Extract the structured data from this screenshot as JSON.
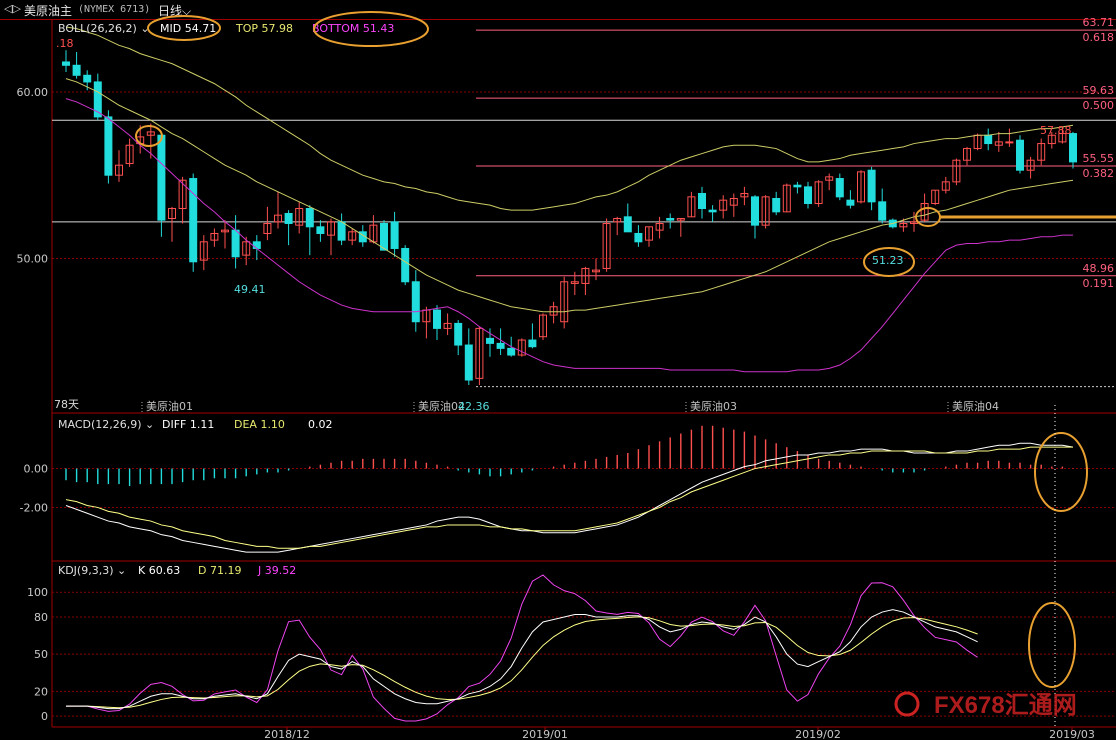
{
  "header": {
    "window_icon": "window-toggle-icon",
    "instrument": "美原油主",
    "code": "(NYMEX 6713)",
    "period": "日线"
  },
  "colors": {
    "up": "#ff5050",
    "down": "#22dddd",
    "boll_mid": "#cccc66",
    "boll_top": "#cccc66",
    "boll_bottom": "#cc33cc",
    "macd_diff": "#ffffff",
    "macd_dea": "#ffff88",
    "kdj_k": "#ffffff",
    "kdj_d": "#ffff88",
    "kdj_j": "#ee44ee",
    "grid": "#8a0000",
    "fib": "#ff6080",
    "annotation": "#e8a030"
  },
  "boll_panel": {
    "label": "BOLL(26,26,2)",
    "mid": "MID 54.71",
    "top": "TOP 57.98",
    "bottom": "BOTTOM 51.43",
    "cut_value": ".18",
    "y_ticks": [
      "60.00",
      "50.00"
    ],
    "days_label": "78天",
    "month_marks": [
      "美原油01",
      "美原油02",
      "美原油03",
      "美原油04"
    ],
    "low_label": "42.36",
    "left_low_label": "49.41",
    "highlight_label": "51.23",
    "high_label": "57.88",
    "fib_levels": [
      {
        "price": "63.71",
        "ratio": "0.618"
      },
      {
        "price": "59.63",
        "ratio": "0.500"
      },
      {
        "price": "55.55",
        "ratio": "0.382"
      },
      {
        "price": "48.96",
        "ratio": "0.191"
      }
    ]
  },
  "macd_panel": {
    "label": "MACD(12,26,9)",
    "diff": "DIFF 1.11",
    "dea": "DEA 1.10",
    "macd": "0.02",
    "y_ticks": [
      "0.00",
      "-2.00"
    ]
  },
  "kdj_panel": {
    "label": "KDJ(9,3,3)",
    "k": "K 60.63",
    "d": "D 71.19",
    "j": "J 39.52",
    "y_ticks": [
      "100",
      "80",
      "50",
      "20",
      "0"
    ]
  },
  "x_axis": [
    "2018/12",
    "2019/01",
    "2019/02",
    "2019/03"
  ],
  "watermark": "FX678汇通网",
  "chart_data": {
    "type": "candlestick",
    "title": "美原油主 (NYMEX 6713) 日线",
    "ylim": [
      41.5,
      64.2
    ],
    "candles": [
      [
        61.8,
        62.5,
        61.2,
        61.6
      ],
      [
        61.6,
        62.4,
        60.8,
        61.0
      ],
      [
        61.0,
        61.3,
        60.1,
        60.6
      ],
      [
        60.6,
        61.1,
        58.3,
        58.5
      ],
      [
        58.5,
        58.9,
        54.5,
        55.0
      ],
      [
        55.0,
        56.5,
        54.6,
        55.6
      ],
      [
        55.7,
        57.2,
        55.5,
        56.8
      ],
      [
        56.9,
        58.0,
        56.3,
        57.3
      ],
      [
        57.4,
        58.1,
        56.0,
        57.6
      ],
      [
        57.4,
        57.5,
        51.3,
        52.3
      ],
      [
        52.4,
        53.1,
        51.0,
        53.0
      ],
      [
        53.0,
        54.9,
        52.1,
        54.7
      ],
      [
        54.8,
        55.1,
        49.2,
        49.8
      ],
      [
        49.9,
        51.4,
        49.3,
        51.0
      ],
      [
        51.1,
        51.8,
        50.7,
        51.5
      ],
      [
        51.6,
        52.3,
        50.6,
        51.7
      ],
      [
        51.7,
        52.6,
        49.4,
        50.1
      ],
      [
        50.2,
        51.3,
        49.6,
        51.0
      ],
      [
        51.0,
        51.4,
        49.9,
        50.6
      ],
      [
        51.5,
        53.1,
        51.1,
        52.1
      ],
      [
        52.2,
        54.0,
        51.8,
        52.6
      ],
      [
        52.7,
        52.9,
        50.8,
        52.1
      ],
      [
        52.0,
        53.4,
        51.5,
        53.0
      ],
      [
        53.0,
        53.2,
        50.2,
        51.9
      ],
      [
        51.9,
        52.3,
        51.0,
        51.5
      ],
      [
        51.4,
        52.4,
        50.2,
        52.2
      ],
      [
        52.2,
        52.7,
        50.8,
        51.1
      ],
      [
        51.1,
        51.8,
        50.8,
        51.6
      ],
      [
        51.6,
        52.0,
        50.7,
        51.0
      ],
      [
        51.0,
        52.6,
        50.9,
        52.0
      ],
      [
        52.1,
        52.3,
        50.5,
        50.5
      ],
      [
        52.2,
        52.8,
        50.1,
        50.6
      ],
      [
        50.6,
        50.8,
        48.4,
        48.6
      ],
      [
        48.6,
        49.3,
        45.6,
        46.2
      ],
      [
        46.2,
        47.1,
        45.2,
        46.9
      ],
      [
        46.9,
        47.2,
        45.1,
        45.8
      ],
      [
        45.8,
        46.7,
        45.4,
        46.1
      ],
      [
        46.1,
        46.3,
        44.2,
        44.8
      ],
      [
        44.8,
        45.8,
        42.4,
        42.7
      ],
      [
        42.8,
        45.9,
        42.4,
        45.8
      ],
      [
        45.2,
        45.8,
        44.1,
        44.9
      ],
      [
        44.9,
        45.8,
        44.2,
        44.6
      ],
      [
        44.6,
        45.3,
        44.1,
        44.2
      ],
      [
        44.2,
        45.2,
        44.1,
        45.1
      ],
      [
        45.1,
        46.1,
        44.6,
        44.7
      ],
      [
        45.3,
        46.7,
        45.1,
        46.6
      ],
      [
        46.6,
        47.4,
        46.1,
        47.1
      ],
      [
        46.2,
        48.9,
        45.8,
        48.6
      ],
      [
        48.5,
        49.2,
        47.8,
        48.6
      ],
      [
        48.5,
        49.5,
        47.8,
        49.4
      ],
      [
        49.2,
        50.0,
        48.7,
        49.3
      ],
      [
        49.4,
        52.4,
        49.2,
        52.1
      ],
      [
        52.2,
        52.5,
        51.4,
        52.4
      ],
      [
        52.5,
        53.3,
        51.7,
        51.6
      ],
      [
        51.5,
        52.0,
        50.7,
        51.0
      ],
      [
        51.1,
        51.9,
        50.7,
        51.9
      ],
      [
        51.7,
        52.5,
        51.2,
        52.1
      ],
      [
        52.4,
        52.7,
        51.8,
        52.3
      ],
      [
        52.3,
        52.4,
        51.3,
        52.4
      ],
      [
        52.5,
        54.0,
        52.5,
        53.7
      ],
      [
        53.9,
        54.3,
        52.4,
        53.0
      ],
      [
        52.9,
        53.2,
        52.2,
        52.8
      ],
      [
        52.9,
        53.8,
        52.4,
        53.5
      ],
      [
        53.2,
        53.9,
        52.5,
        53.6
      ],
      [
        53.7,
        54.3,
        53.2,
        53.9
      ],
      [
        53.7,
        53.8,
        51.2,
        52.0
      ],
      [
        52.0,
        53.8,
        51.8,
        53.7
      ],
      [
        53.6,
        54.0,
        52.6,
        52.8
      ],
      [
        52.8,
        54.5,
        52.8,
        54.4
      ],
      [
        54.4,
        54.6,
        53.9,
        54.3
      ],
      [
        54.3,
        54.6,
        53.0,
        53.3
      ],
      [
        53.3,
        54.7,
        53.1,
        54.6
      ],
      [
        54.7,
        55.1,
        54.1,
        54.9
      ],
      [
        54.8,
        55.1,
        53.5,
        53.7
      ],
      [
        53.5,
        54.1,
        53.0,
        53.2
      ],
      [
        53.4,
        55.3,
        53.3,
        55.2
      ],
      [
        55.3,
        55.5,
        52.9,
        53.4
      ],
      [
        53.4,
        54.2,
        52.1,
        52.3
      ],
      [
        52.3,
        52.4,
        51.8,
        51.9
      ],
      [
        51.9,
        52.4,
        51.6,
        52.1
      ],
      [
        52.1,
        52.8,
        51.6,
        52.2
      ],
      [
        52.3,
        53.9,
        52.2,
        53.3
      ],
      [
        53.3,
        54.1,
        53.2,
        54.1
      ],
      [
        54.1,
        54.9,
        53.9,
        54.6
      ],
      [
        54.6,
        56.0,
        54.4,
        55.9
      ],
      [
        55.9,
        56.7,
        55.6,
        56.6
      ],
      [
        56.6,
        57.5,
        56.5,
        57.4
      ],
      [
        57.4,
        57.8,
        56.5,
        56.9
      ],
      [
        56.8,
        57.6,
        56.4,
        57.0
      ],
      [
        57.0,
        57.8,
        56.7,
        57.0
      ],
      [
        57.1,
        57.4,
        55.1,
        55.3
      ],
      [
        55.3,
        56.1,
        54.8,
        55.9
      ],
      [
        55.9,
        57.2,
        55.6,
        56.9
      ],
      [
        56.9,
        57.6,
        56.6,
        57.4
      ],
      [
        57.0,
        57.9,
        56.9,
        57.5
      ],
      [
        57.5,
        57.6,
        55.4,
        55.8
      ]
    ],
    "boll_mid": [
      60.8,
      60.6,
      60.3,
      60.0,
      59.6,
      59.2,
      58.9,
      58.6,
      58.3,
      57.9,
      57.5,
      57.2,
      56.8,
      56.4,
      56.0,
      55.6,
      55.3,
      55.0,
      54.6,
      54.3,
      54.0,
      53.7,
      53.4,
      53.1,
      52.8,
      52.5,
      52.2,
      51.8,
      51.4,
      51.0,
      50.6,
      50.2,
      49.8,
      49.4,
      49.0,
      48.7,
      48.4,
      48.1,
      47.9,
      47.7,
      47.5,
      47.3,
      47.1,
      47.0,
      46.9,
      46.8,
      46.8,
      46.8,
      46.9,
      46.9,
      47.0,
      47.1,
      47.2,
      47.3,
      47.4,
      47.5,
      47.6,
      47.7,
      47.8,
      47.9,
      48.0,
      48.2,
      48.4,
      48.6,
      48.8,
      49.0,
      49.2,
      49.5,
      49.8,
      50.1,
      50.4,
      50.7,
      51.0,
      51.2,
      51.4,
      51.6,
      51.8,
      52.0,
      52.1,
      52.3,
      52.5,
      52.6,
      52.8,
      52.9,
      53.1,
      53.3,
      53.5,
      53.7,
      53.9,
      54.1,
      54.2,
      54.3,
      54.4,
      54.5,
      54.6,
      54.7
    ],
    "boll_top": [
      63.9,
      63.8,
      63.6,
      63.4,
      63.1,
      62.8,
      62.6,
      62.3,
      62.1,
      61.9,
      61.7,
      61.4,
      61.1,
      60.8,
      60.5,
      60.1,
      59.7,
      59.2,
      58.8,
      58.4,
      58.0,
      57.6,
      57.2,
      56.8,
      56.3,
      55.9,
      55.6,
      55.3,
      55.0,
      54.8,
      54.6,
      54.5,
      54.3,
      54.2,
      54.0,
      53.9,
      53.7,
      53.5,
      53.4,
      53.3,
      53.2,
      53.0,
      52.9,
      52.9,
      52.9,
      53.0,
      53.1,
      53.2,
      53.3,
      53.5,
      53.7,
      53.8,
      54.0,
      54.3,
      54.6,
      55.0,
      55.3,
      55.6,
      55.9,
      56.1,
      56.3,
      56.5,
      56.7,
      56.8,
      56.8,
      56.8,
      56.7,
      56.6,
      56.3,
      56.0,
      55.8,
      55.8,
      55.9,
      56.0,
      56.2,
      56.3,
      56.4,
      56.5,
      56.6,
      56.7,
      56.9,
      57.0,
      57.1,
      57.2,
      57.2,
      57.3,
      57.4,
      57.4,
      57.5,
      57.5,
      57.6,
      57.7,
      57.8,
      57.8,
      57.9,
      58.0
    ],
    "boll_bottom": [
      59.6,
      59.4,
      59.1,
      58.8,
      58.4,
      57.9,
      57.4,
      56.8,
      56.3,
      55.7,
      55.1,
      54.5,
      53.9,
      53.3,
      52.8,
      52.2,
      51.7,
      51.1,
      50.6,
      50.1,
      49.6,
      49.1,
      48.6,
      48.2,
      47.8,
      47.5,
      47.2,
      47.0,
      46.9,
      46.8,
      46.8,
      46.8,
      46.8,
      46.8,
      46.9,
      47.0,
      47.1,
      46.8,
      46.4,
      45.9,
      45.5,
      45.1,
      44.7,
      44.4,
      44.1,
      43.8,
      43.6,
      43.5,
      43.4,
      43.4,
      43.4,
      43.4,
      43.4,
      43.4,
      43.4,
      43.4,
      43.4,
      43.3,
      43.3,
      43.3,
      43.3,
      43.3,
      43.3,
      43.3,
      43.2,
      43.2,
      43.2,
      43.2,
      43.2,
      43.3,
      43.3,
      43.3,
      43.4,
      43.6,
      44.0,
      44.5,
      45.2,
      45.9,
      46.7,
      47.5,
      48.3,
      49.1,
      49.8,
      50.5,
      50.8,
      50.9,
      50.9,
      51.0,
      51.0,
      51.1,
      51.1,
      51.2,
      51.3,
      51.3,
      51.4,
      51.4
    ],
    "macd_diff": [
      -1.9,
      -2.1,
      -2.3,
      -2.5,
      -2.7,
      -2.8,
      -3.0,
      -3.1,
      -3.2,
      -3.4,
      -3.5,
      -3.7,
      -3.8,
      -3.9,
      -4.0,
      -4.1,
      -4.2,
      -4.3,
      -4.3,
      -4.3,
      -4.3,
      -4.2,
      -4.1,
      -4.0,
      -3.9,
      -3.8,
      -3.7,
      -3.6,
      -3.5,
      -3.4,
      -3.3,
      -3.2,
      -3.1,
      -3.0,
      -2.9,
      -2.7,
      -2.6,
      -2.5,
      -2.5,
      -2.6,
      -2.8,
      -3.0,
      -3.1,
      -3.2,
      -3.2,
      -3.3,
      -3.3,
      -3.3,
      -3.3,
      -3.2,
      -3.1,
      -3.0,
      -2.9,
      -2.7,
      -2.5,
      -2.2,
      -1.9,
      -1.6,
      -1.3,
      -1.0,
      -0.7,
      -0.5,
      -0.3,
      -0.1,
      0.1,
      0.2,
      0.4,
      0.5,
      0.6,
      0.7,
      0.7,
      0.8,
      0.8,
      0.9,
      0.9,
      1.0,
      1.0,
      1.0,
      0.9,
      0.9,
      0.8,
      0.8,
      0.8,
      0.8,
      0.9,
      0.9,
      1.0,
      1.1,
      1.2,
      1.2,
      1.3,
      1.3,
      1.2,
      1.2,
      1.2,
      1.1
    ],
    "macd_dea": [
      -1.6,
      -1.7,
      -1.9,
      -2.0,
      -2.2,
      -2.3,
      -2.5,
      -2.6,
      -2.7,
      -2.9,
      -3.0,
      -3.2,
      -3.3,
      -3.4,
      -3.5,
      -3.7,
      -3.8,
      -3.9,
      -4.0,
      -4.0,
      -4.1,
      -4.1,
      -4.1,
      -4.0,
      -4.0,
      -3.9,
      -3.8,
      -3.7,
      -3.6,
      -3.5,
      -3.4,
      -3.3,
      -3.2,
      -3.1,
      -3.0,
      -3.0,
      -2.9,
      -2.9,
      -2.9,
      -2.9,
      -3.0,
      -3.0,
      -3.1,
      -3.1,
      -3.2,
      -3.2,
      -3.2,
      -3.2,
      -3.2,
      -3.1,
      -3.0,
      -2.9,
      -2.8,
      -2.6,
      -2.4,
      -2.2,
      -2.0,
      -1.7,
      -1.5,
      -1.2,
      -1.0,
      -0.8,
      -0.6,
      -0.4,
      -0.2,
      0.0,
      0.1,
      0.2,
      0.3,
      0.4,
      0.5,
      0.6,
      0.7,
      0.7,
      0.8,
      0.8,
      0.9,
      0.9,
      0.9,
      0.9,
      0.9,
      0.9,
      0.8,
      0.8,
      0.8,
      0.8,
      0.9,
      0.9,
      1.0,
      1.0,
      1.0,
      1.1,
      1.1,
      1.1,
      1.1,
      1.1
    ],
    "macd_hist": [
      -0.6,
      -0.7,
      -0.7,
      -0.8,
      -0.8,
      -0.8,
      -0.9,
      -0.8,
      -0.8,
      -0.8,
      -0.8,
      -0.7,
      -0.6,
      -0.6,
      -0.5,
      -0.5,
      -0.5,
      -0.4,
      -0.3,
      -0.2,
      -0.2,
      -0.1,
      0.0,
      0.1,
      0.2,
      0.3,
      0.4,
      0.4,
      0.5,
      0.5,
      0.5,
      0.5,
      0.5,
      0.4,
      0.3,
      0.2,
      0.1,
      -0.1,
      -0.2,
      -0.3,
      -0.4,
      -0.4,
      -0.3,
      -0.2,
      -0.1,
      0.0,
      0.1,
      0.2,
      0.3,
      0.4,
      0.5,
      0.6,
      0.7,
      0.8,
      1.0,
      1.2,
      1.4,
      1.6,
      1.8,
      2.0,
      2.2,
      2.2,
      2.1,
      2.0,
      1.9,
      1.7,
      1.5,
      1.3,
      1.1,
      0.9,
      0.7,
      0.5,
      0.4,
      0.3,
      0.2,
      0.1,
      0.0,
      -0.1,
      -0.2,
      -0.2,
      -0.2,
      -0.1,
      0.0,
      0.1,
      0.2,
      0.3,
      0.3,
      0.4,
      0.4,
      0.3,
      0.3,
      0.2,
      0.2,
      0.1,
      0.1,
      0.02
    ],
    "kdj_k": [
      8,
      8,
      8,
      7,
      6,
      6,
      8,
      12,
      16,
      18,
      18,
      16,
      14,
      14,
      16,
      17,
      18,
      16,
      14,
      18,
      32,
      45,
      50,
      48,
      46,
      40,
      38,
      44,
      40,
      30,
      24,
      18,
      14,
      11,
      10,
      10,
      12,
      14,
      18,
      20,
      24,
      30,
      40,
      55,
      68,
      76,
      78,
      80,
      82,
      82,
      80,
      80,
      80,
      81,
      81,
      78,
      72,
      68,
      70,
      74,
      76,
      75,
      72,
      70,
      74,
      80,
      76,
      64,
      50,
      42,
      40,
      44,
      48,
      52,
      60,
      72,
      80,
      84,
      86,
      84,
      80,
      76,
      72,
      70,
      68,
      64,
      60
    ]
  }
}
